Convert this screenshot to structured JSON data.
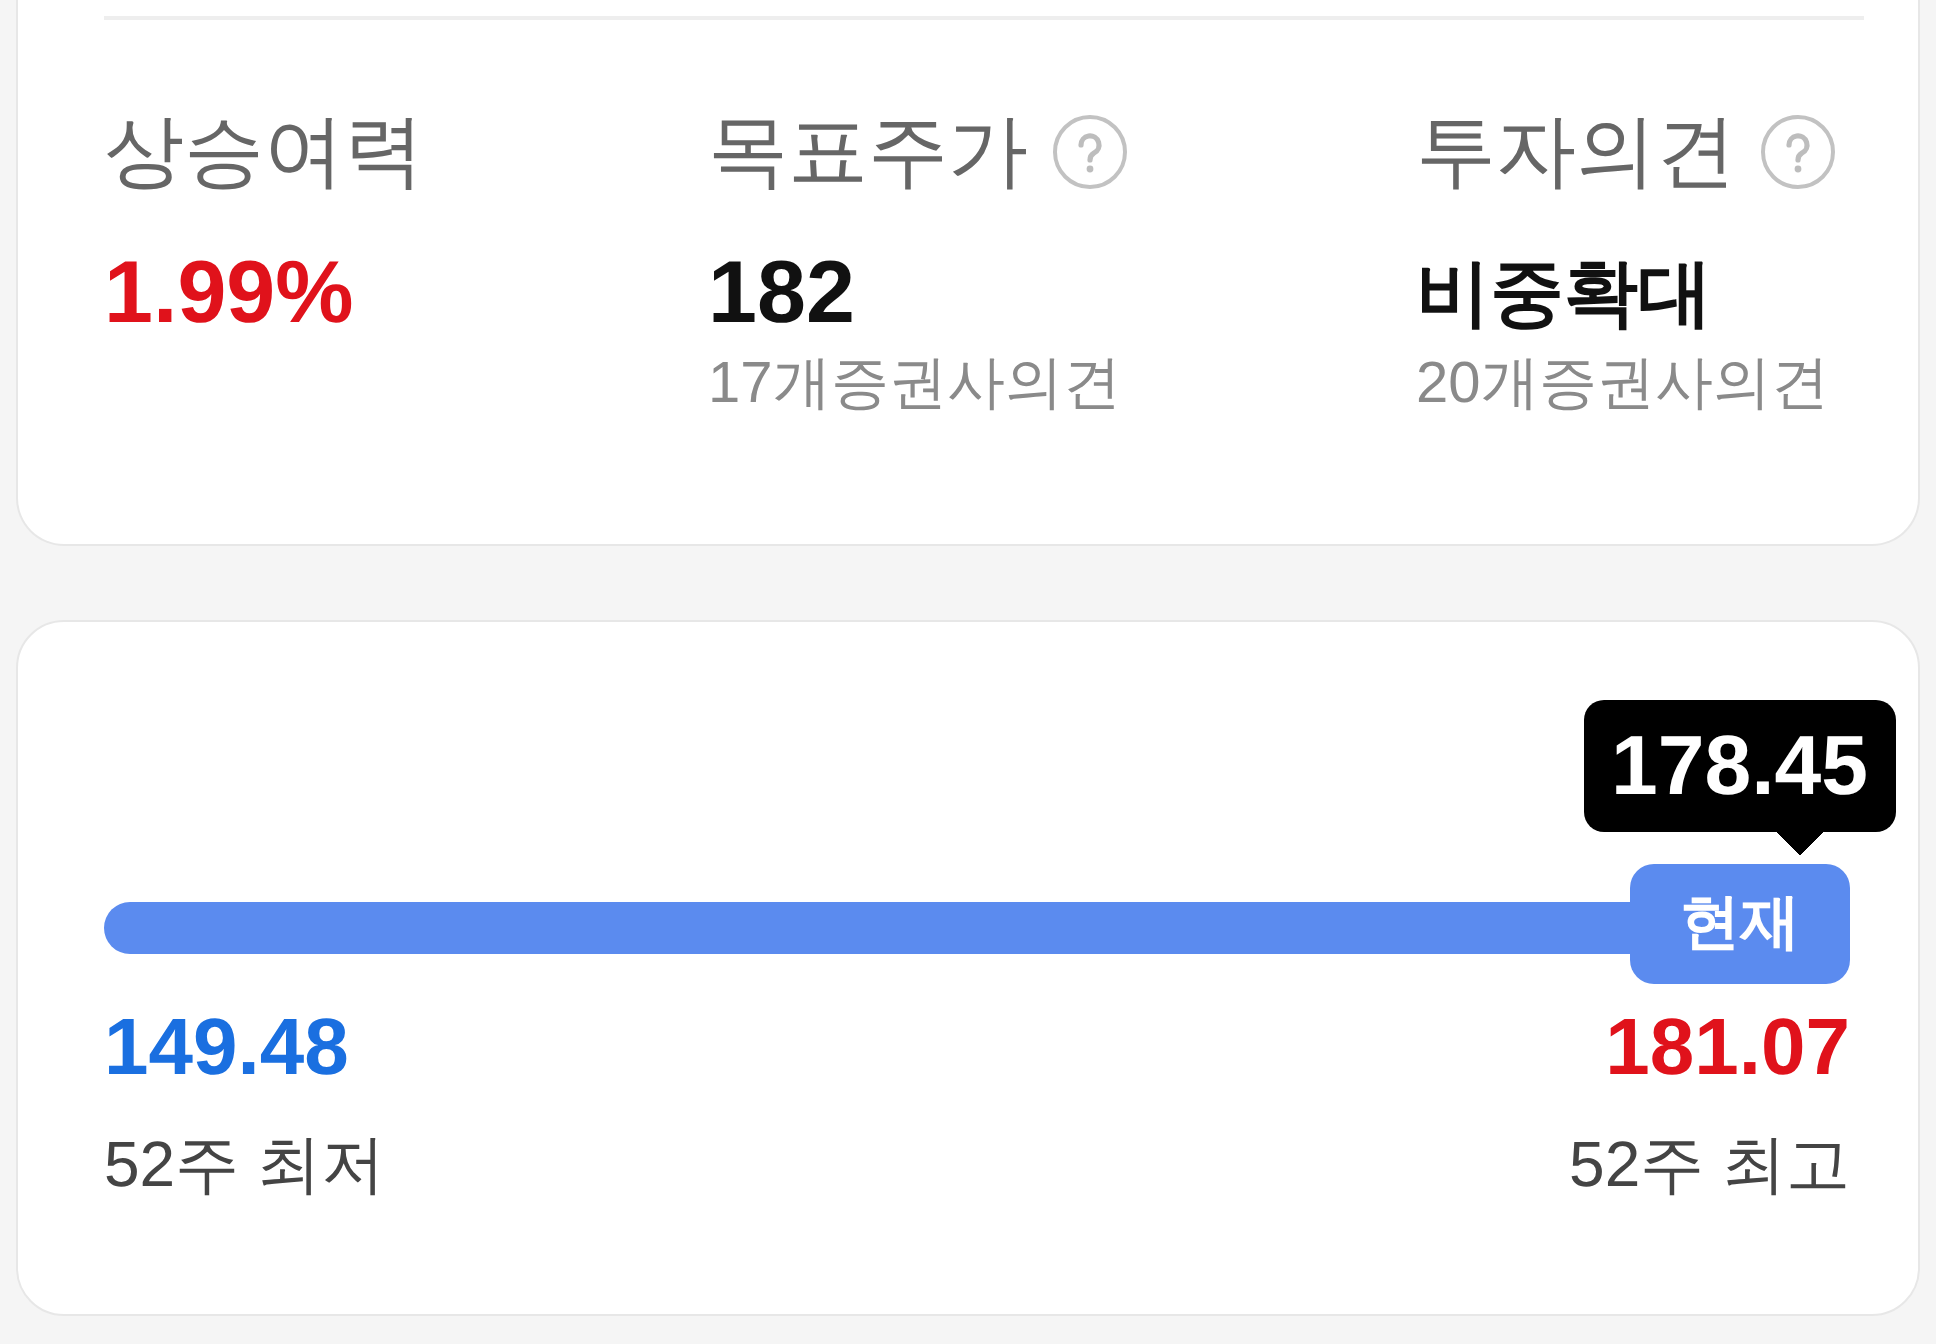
{
  "summary": {
    "items": [
      {
        "label": "상승여력",
        "help": false,
        "value": "1.99%",
        "color": "#e0121b"
      },
      {
        "label": "목표주가",
        "help": true,
        "value": "182",
        "color": "#111111",
        "note": "17개증권사의견"
      },
      {
        "label": "투자의견",
        "help": true,
        "value": "비중확대",
        "color": "#111111",
        "note": "20개증권사의견"
      }
    ]
  },
  "range": {
    "current": {
      "label": "현재",
      "value": "178.45",
      "level": 0.94
    },
    "ends": [
      {
        "value": "149.48",
        "label": "52주 최저",
        "color": "#1a6fe0"
      },
      {
        "value": "181.07",
        "label": "52주 최고",
        "color": "#e0121b"
      }
    ]
  }
}
